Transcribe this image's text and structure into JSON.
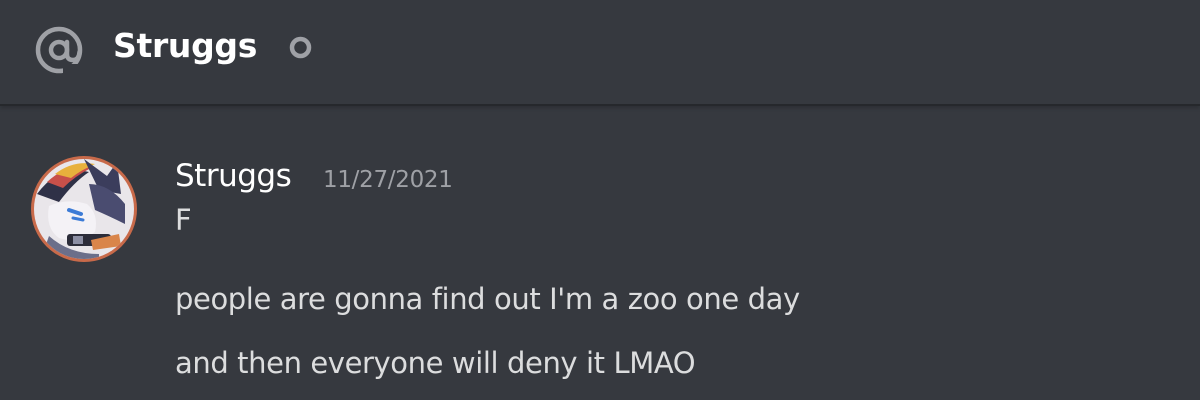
{
  "header": {
    "channel_icon": "at-icon",
    "title": "Struggs",
    "status_icon": "status-offline-icon"
  },
  "message_group": {
    "username": "Struggs",
    "timestamp": "11/27/2021",
    "avatar_icon": "avatar",
    "lines": [
      "F",
      "people are gonna find out I'm a zoo one day",
      "and then everyone will deny it LMAO"
    ]
  },
  "colors": {
    "background": "#36393f",
    "header_text": "#ffffff",
    "message_text": "#dcddde",
    "timestamp_text": "#9fa1a6",
    "icon_gray": "#9fa1a6"
  }
}
